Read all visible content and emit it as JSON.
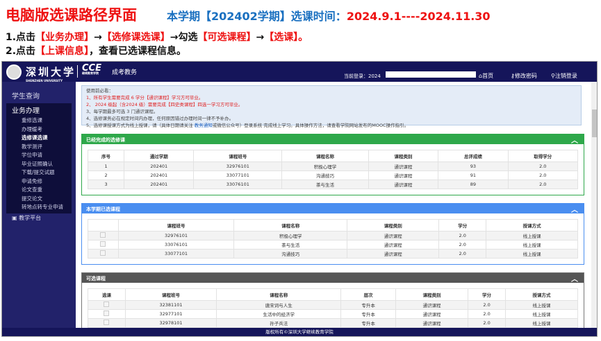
{
  "slide": {
    "title": "电脑版选课路径界面",
    "term_prefix": "本学期【202402学期】选课时间：",
    "term_dates": "2024.9.1----2024.11.30",
    "step1": [
      "1.点击",
      "【业务办理】",
      "→",
      "【选修课选课】",
      "→勾选",
      "【可选课程】",
      "→",
      "【选课】",
      "。"
    ],
    "step2": [
      "2.点击",
      "【上课信息】",
      "，查看已选课程信息。"
    ]
  },
  "header": {
    "school": "深圳大学",
    "school_en": "SHENZHEN UNIVERSITY",
    "cce": "CCE",
    "cce_sub": "继续教育学院",
    "system": "成考教务",
    "login_label": "当前登录：",
    "login_value": "2024",
    "home": "首页",
    "change_pwd": "修改密码",
    "logout": "注销登录"
  },
  "sidebar": {
    "query": "学生查询",
    "business": "业务办理",
    "items": [
      "重修选课",
      "办理缓考",
      "选修课选课",
      "教学测评",
      "学位申请",
      "毕业证照确认",
      "下载/提交试题",
      "申请免修",
      "论文查重",
      "提交论文",
      "转地点转专业申请"
    ],
    "platform": "教学平台"
  },
  "notice": {
    "title": "使用前必看：",
    "lines": [
      "1、所有学生需要完成 6 学分【通识课程】学习方可毕业。",
      "2、 2024 级起（含2024 级）需要完成【四史类课程】四选一学习方可毕业。",
      "3、每学期最多可选 3 门通识课程。",
      "4、选修课务必在规定时间内办理，任何原因错过办理时间一律不予补办。"
    ],
    "line5a": "5、选修课授课方式为线上授课，请（具体日期请关注 ",
    "line5b": "教务通知",
    "line5c": "或微信公众号）登录系统 完成线上学习。具体操作方法，请查看学院网站发布的MOOC操作指引。"
  },
  "completed": {
    "title": "已经完成的选修课",
    "headers": [
      "序号",
      "通过学期",
      "课程班号",
      "课程名称",
      "课程类别",
      "总评成绩",
      "取得学分"
    ],
    "rows": [
      [
        "1",
        "202401",
        "32976101",
        "积极心理学",
        "通识课程",
        "93",
        "2.0"
      ],
      [
        "2",
        "202401",
        "33077101",
        "沟通技巧",
        "通识课程",
        "91",
        "2.0"
      ],
      [
        "3",
        "202401",
        "33076101",
        "茶与生活",
        "通识课程",
        "89",
        "2.0"
      ]
    ]
  },
  "selected": {
    "title": "本学期已选课程",
    "headers": [
      "",
      "课程班号",
      "课程名称",
      "课程类别",
      "学分",
      "授课方式"
    ],
    "rows": [
      [
        "32976101",
        "积极心理学",
        "通识课程",
        "2.0",
        "线上授课"
      ],
      [
        "33076101",
        "茶与生活",
        "通识课程",
        "2.0",
        "线上授课"
      ],
      [
        "33077101",
        "沟通技巧",
        "通识课程",
        "2.0",
        "线上授课"
      ]
    ]
  },
  "available": {
    "title": "可选课程",
    "headers": [
      "选课",
      "课程班号",
      "课程名称",
      "层次",
      "课程类别",
      "学分",
      "授课方式"
    ],
    "rows": [
      [
        "32381101",
        "唐宋词与人生",
        "专升本",
        "通识课程",
        "2.0",
        "线上授课"
      ],
      [
        "32977101",
        "生活中的经济学",
        "专升本",
        "通识课程",
        "2.0",
        "线上授课"
      ],
      [
        "32978101",
        "孙子兵法",
        "专升本",
        "通识课程",
        "2.0",
        "线上授课"
      ]
    ]
  },
  "footer": "版权所有©深圳大学继续教育学院",
  "colors": {
    "navy": "#15155a",
    "green": "#2ea84a",
    "blue": "#4a8ef0",
    "dark": "#555555",
    "red": "#ee1111"
  }
}
